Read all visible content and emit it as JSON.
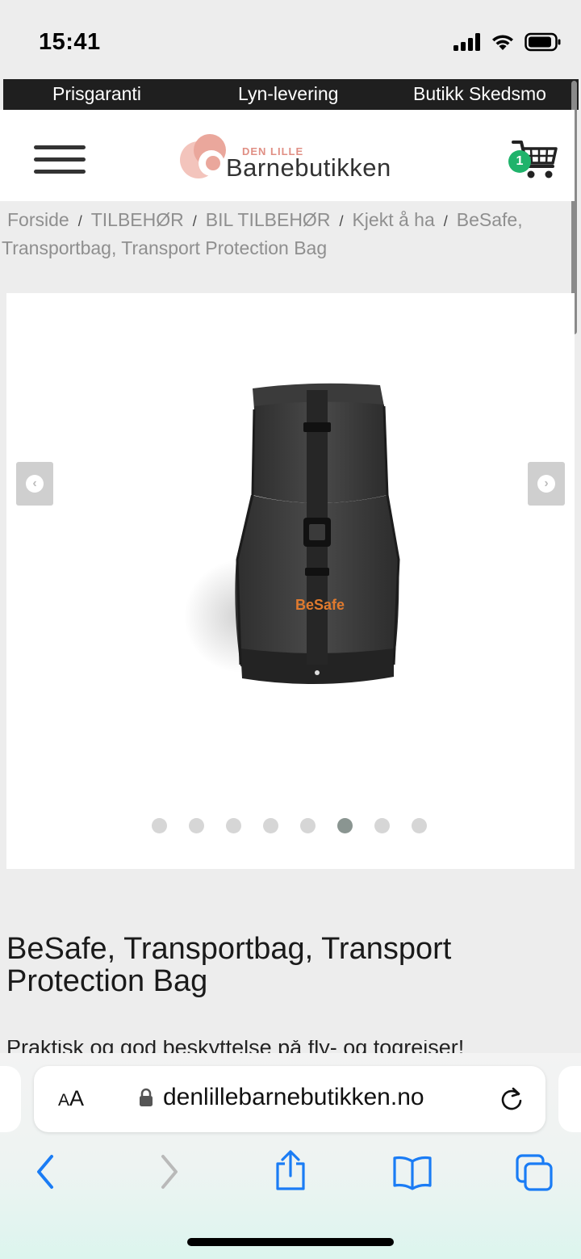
{
  "status": {
    "time": "15:41"
  },
  "promo": {
    "items": [
      "Prisgaranti",
      "Lyn-levering",
      "Butikk Skedsmo"
    ]
  },
  "header": {
    "logo_small": "DEN LILLE",
    "logo_big": "Barnebutikken",
    "cart_count": "1"
  },
  "breadcrumb": {
    "items": [
      "Forside",
      "TILBEHØR",
      "BIL TILBEHØR",
      "Kjekt å ha",
      "BeSafe,",
      "Transportbag, Transport Protection Bag"
    ],
    "separator": "/"
  },
  "gallery": {
    "product_image_label": "BeSafe",
    "dot_count": 8,
    "active_index": 5,
    "prev_icon": "chevron-left-icon",
    "next_icon": "chevron-right-icon"
  },
  "product": {
    "title": "BeSafe, Transportbag, Transport Protection Bag",
    "description": "Praktisk og god beskyttelse på fly- og togreiser!"
  },
  "browser": {
    "text_size_label_big": "A",
    "text_size_label_small": "A",
    "url": "denlillebarnebutikken.no"
  },
  "colors": {
    "promo_bg": "#1f1f1f",
    "cart_badge": "#1fb36b",
    "logo_accent": "#e08f84",
    "ios_blue": "#1a7cf5"
  }
}
